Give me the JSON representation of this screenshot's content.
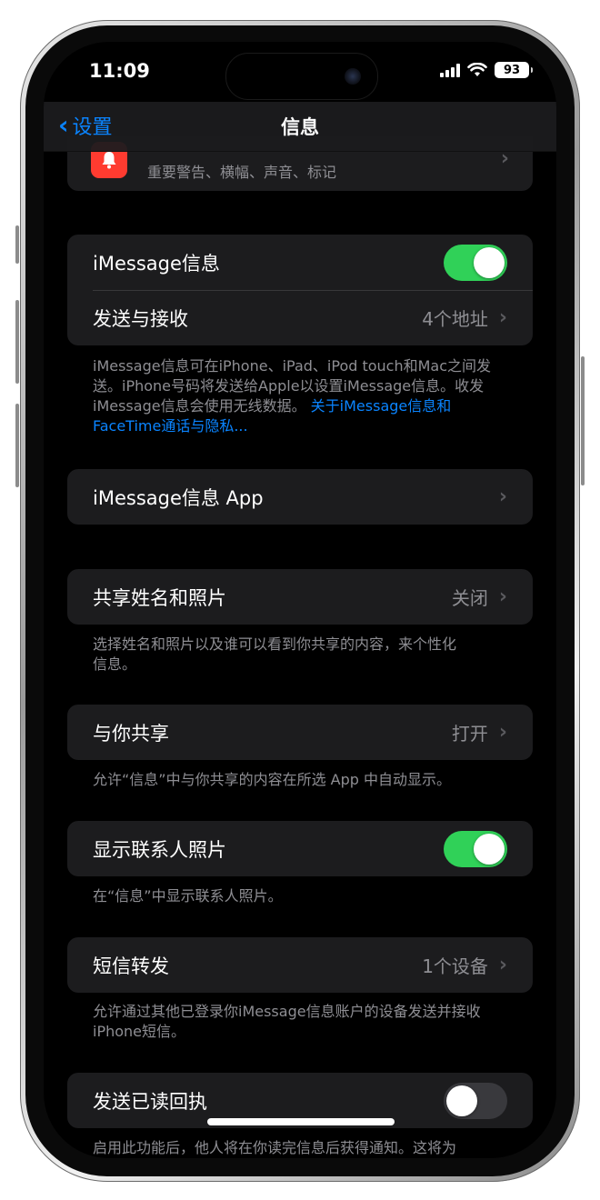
{
  "status": {
    "time": "11:09",
    "battery": "93"
  },
  "nav": {
    "back_label": "设置",
    "title": "信息"
  },
  "notifications_row": {
    "subtitle": "重要警告、横幅、声音、标记"
  },
  "imessage_group": {
    "toggle_label": "iMessage信息",
    "toggle_on": true,
    "send_receive_label": "发送与接收",
    "send_receive_value": "4个地址"
  },
  "imessage_footer": {
    "text": "iMessage信息可在iPhone、iPad、iPod touch和Mac之间发送。iPhone号码将发送给Apple以设置iMessage信息。收发iMessage信息会使用无线数据。",
    "link": "关于iMessage信息和FaceTime通话与隐私..."
  },
  "imessage_apps": {
    "label": "iMessage信息 App"
  },
  "share_name": {
    "label": "共享姓名和照片",
    "value": "关闭",
    "footer": "选择姓名和照片以及谁可以看到你共享的内容，来个性化信息。"
  },
  "shared_with_you": {
    "label": "与你共享",
    "value": "打开",
    "footer": "允许“信息”中与你共享的内容在所选 App 中自动显示。"
  },
  "contact_photos": {
    "label": "显示联系人照片",
    "toggle_on": true,
    "footer": "在“信息”中显示联系人照片。"
  },
  "text_forwarding": {
    "label": "短信转发",
    "value": "1个设备",
    "footer": "允许通过其他已登录你iMessage信息账户的设备发送并接收iPhone短信。"
  },
  "read_receipts": {
    "label": "发送已读回执",
    "toggle_on": false,
    "footer": "启用此功能后，他人将在你读完信息后获得通知。这将为"
  },
  "colors": {
    "accent": "#0a84ff",
    "toggle_on": "#30d158",
    "cell": "#1c1c1e",
    "secondary": "#8e8e93"
  }
}
